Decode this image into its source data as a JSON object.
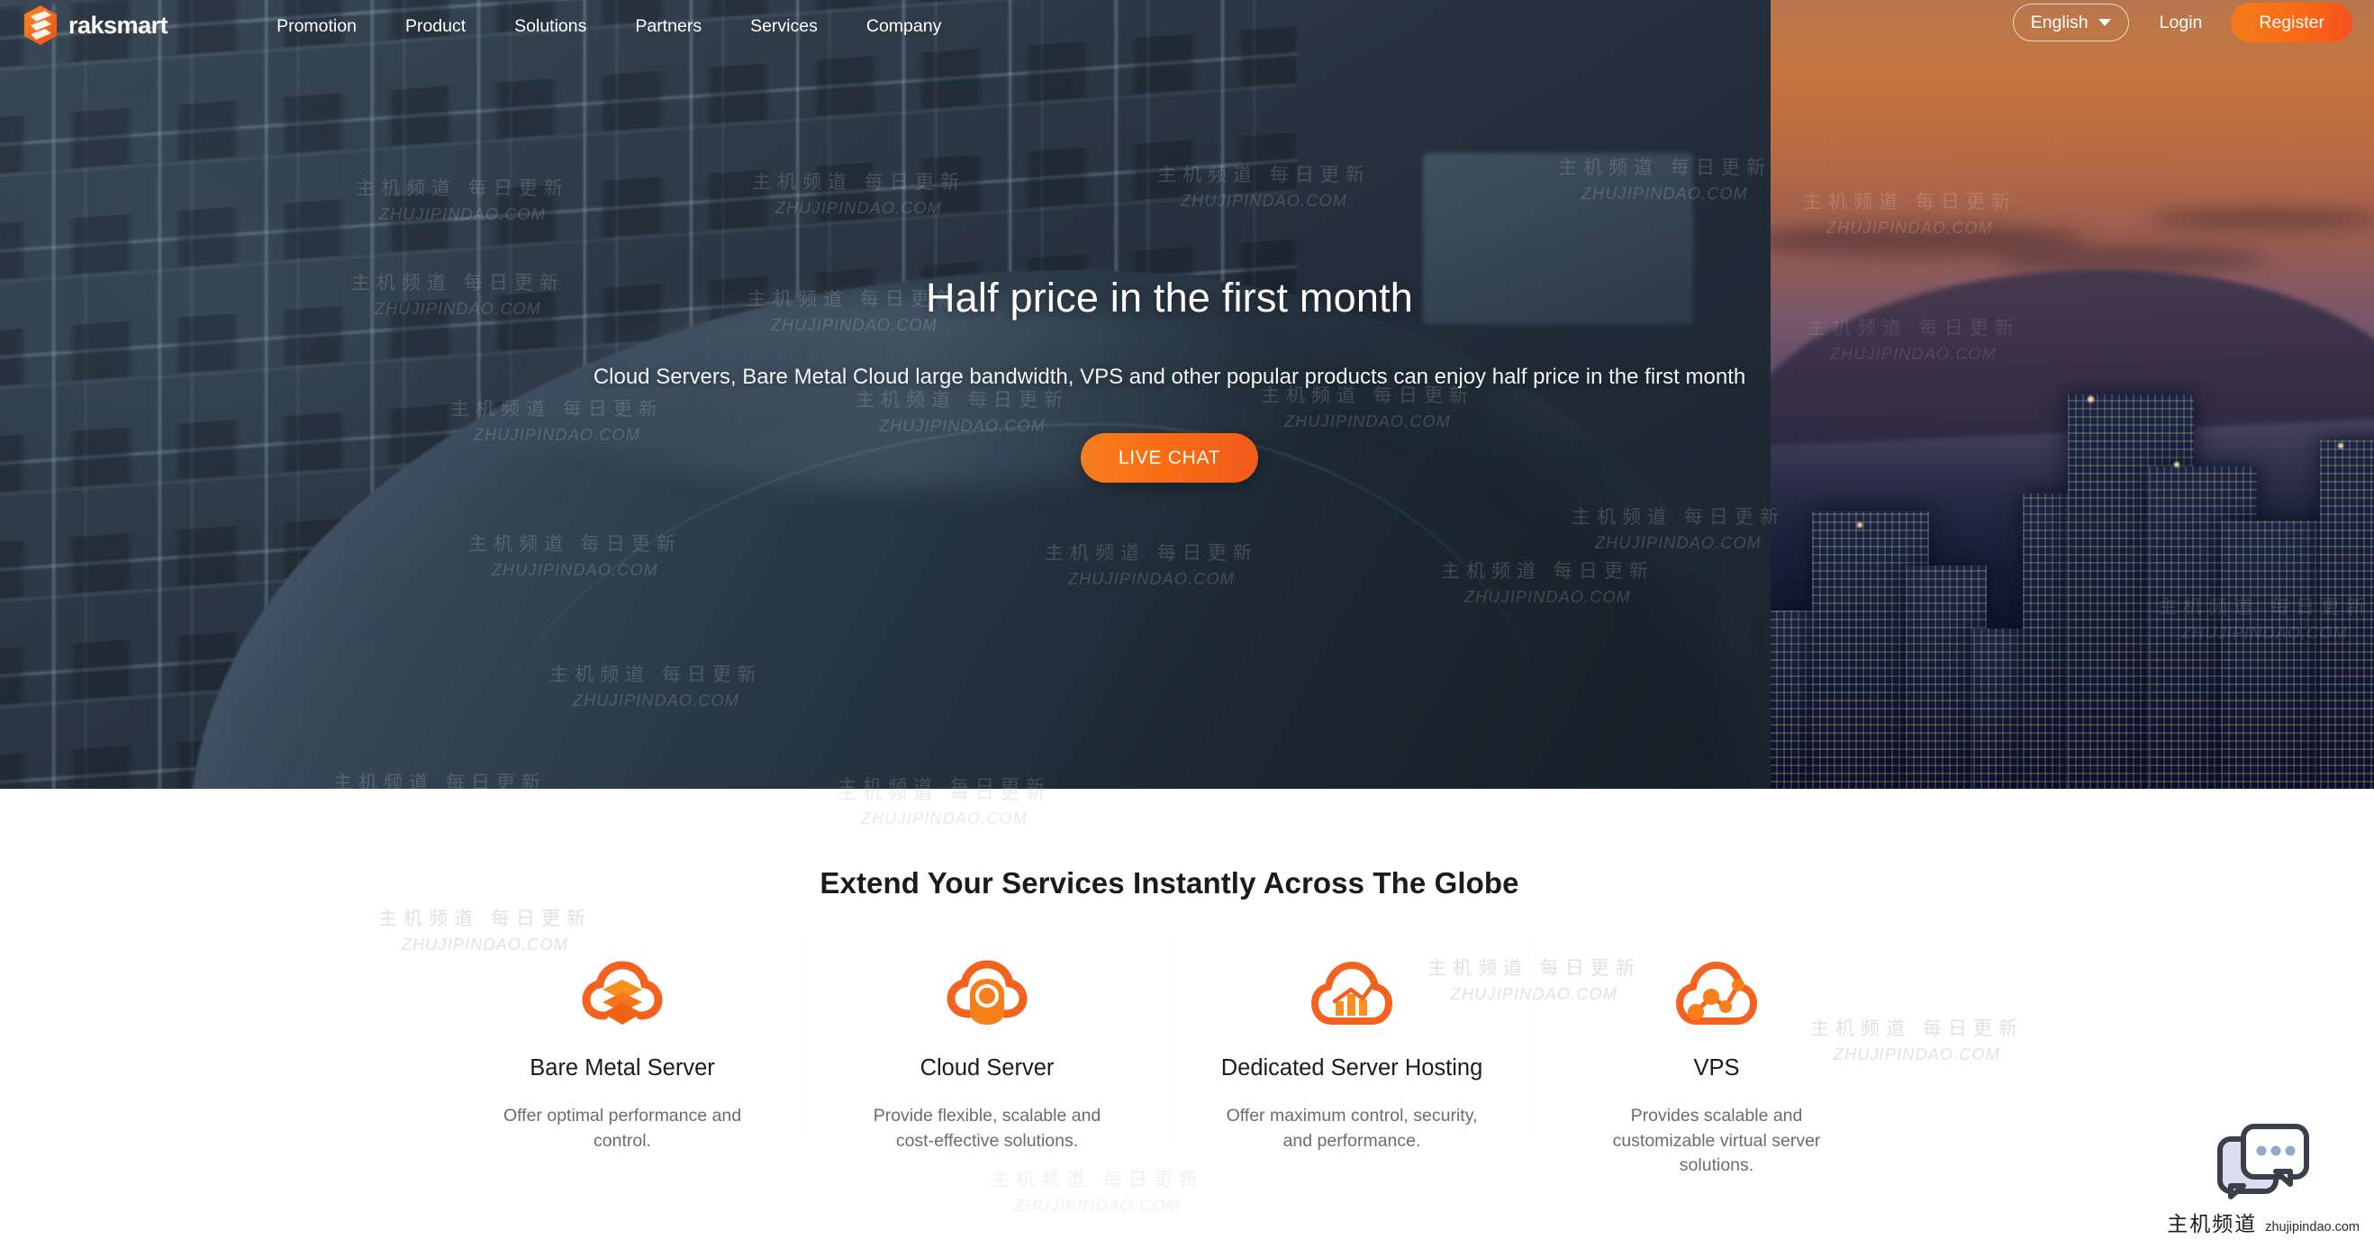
{
  "brand": {
    "name": "raksmart",
    "accent": "#f4621f",
    "logo_icon": "raksmart-hexagon-logo"
  },
  "nav": {
    "items": [
      {
        "label": "Promotion"
      },
      {
        "label": "Product"
      },
      {
        "label": "Solutions"
      },
      {
        "label": "Partners"
      },
      {
        "label": "Services"
      },
      {
        "label": "Company"
      }
    ],
    "language": {
      "label": "English",
      "caret_icon": "chevron-down-icon"
    },
    "login_label": "Login",
    "register_label": "Register"
  },
  "hero": {
    "title": "Half price in the first month",
    "subtitle": "Cloud Servers, Bare Metal Cloud large bandwidth, VPS and other popular products can enjoy half price in the first month",
    "cta_label": "LIVE CHAT"
  },
  "services": {
    "heading": "Extend Your Services Instantly Across The Globe",
    "cards": [
      {
        "icon": "cloud-server-stack-icon",
        "title": "Bare Metal Server",
        "desc": "Offer optimal performance and control."
      },
      {
        "icon": "cloud-user-icon",
        "title": "Cloud Server",
        "desc": "Provide flexible, scalable and cost-effective solutions."
      },
      {
        "icon": "cloud-chart-icon",
        "title": "Dedicated Server Hosting",
        "desc": "Offer maximum control, security, and performance."
      },
      {
        "icon": "cloud-network-icon",
        "title": "VPS",
        "desc": "Provides scalable and customizable virtual server solutions."
      }
    ]
  },
  "watermark": {
    "cn": "主机频道 每日更新",
    "en": "ZHUJIPINDAO.COM"
  },
  "chat_widget": {
    "icon": "chat-bubbles-icon",
    "caption_cn": "主机频道",
    "caption_en": "zhujipindao.com"
  }
}
